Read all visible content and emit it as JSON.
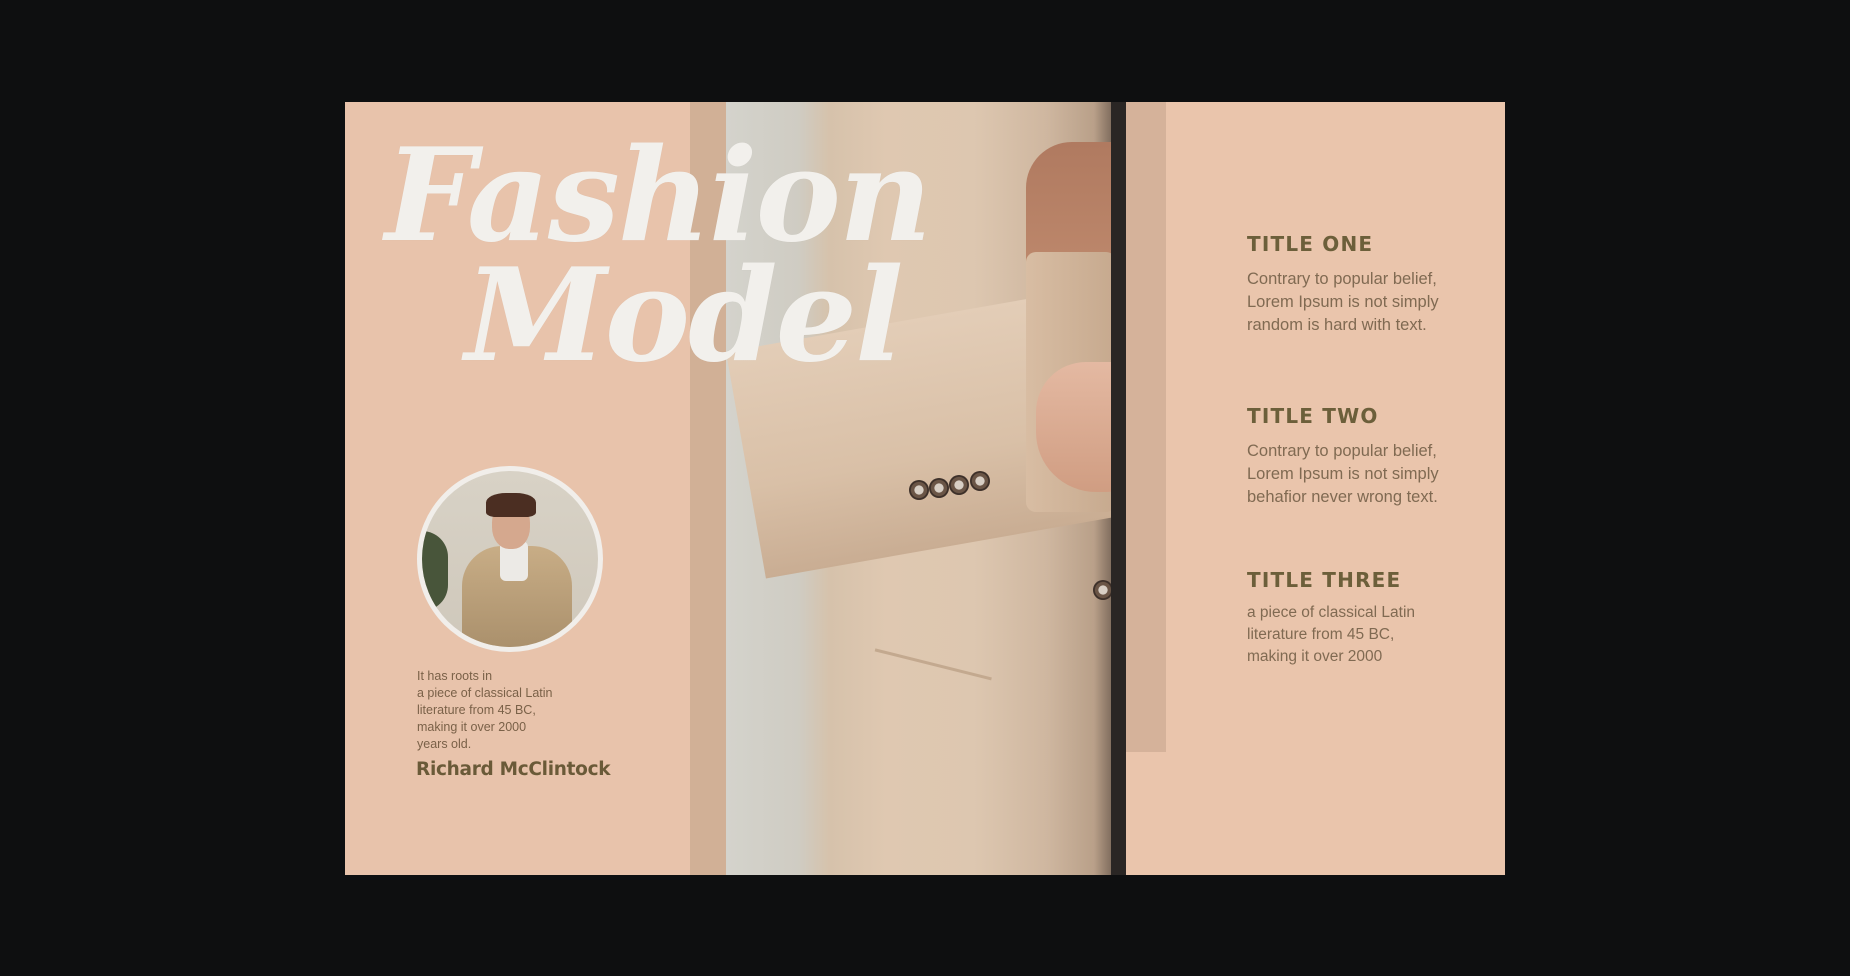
{
  "headline": {
    "line1": "Fashion",
    "line2": "Model"
  },
  "profile": {
    "bio_lines": [
      "It has roots in",
      "a piece of classical Latin",
      "literature from 45 BC,",
      "making it over 2000",
      "years old."
    ],
    "name": "Richard McClintock"
  },
  "sections": [
    {
      "title": "TITLE ONE",
      "lines": [
        "Contrary to popular belief,",
        "Lorem Ipsum is not simply",
        "random is hard with text."
      ]
    },
    {
      "title": "TITLE TWO",
      "lines": [
        "Contrary to popular belief,",
        "Lorem Ipsum is not simply",
        "behafior never wrong text."
      ]
    },
    {
      "title": "TITLE THREE",
      "lines": [
        "a piece of classical Latin",
        "literature from 45 BC,",
        "making it over 2000"
      ]
    }
  ],
  "colors": {
    "background": "#0e0f10",
    "page": "#e8c3ab",
    "stripe": "#d1b096",
    "headline": "#f2f0ec",
    "title": "#6c5f3a",
    "body_text": "#806a52"
  }
}
